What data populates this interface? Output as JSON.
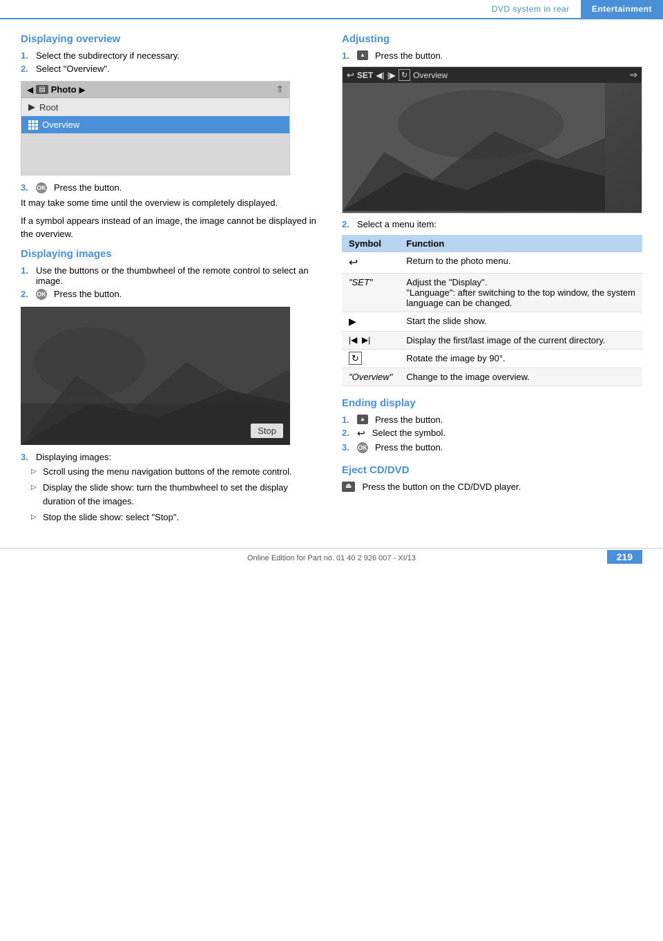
{
  "header": {
    "dvd_label": "DVD system in rear",
    "section_label": "Entertainment"
  },
  "left_col": {
    "section1_title": "Displaying overview",
    "section1_steps": [
      {
        "num": "1.",
        "text": "Select the subdirectory if necessary."
      },
      {
        "num": "2.",
        "text": "Select \"Overview\"."
      }
    ],
    "dvd_menu": {
      "topbar_center": "Photo",
      "row1": "Root",
      "row2_icon": "grid",
      "row2": "Overview"
    },
    "step3_text": "Press the button.",
    "para1": "It may take some time until the overview is completely displayed.",
    "para2": "If a symbol appears instead of an image, the image cannot be displayed in the overview.",
    "section2_title": "Displaying images",
    "section2_steps": [
      {
        "num": "1.",
        "text": "Use the buttons or the thumbwheel of the remote control to select an image."
      },
      {
        "num": "2.",
        "text": "Press the button."
      }
    ],
    "step3b_label": "3.",
    "step3b_text": "Displaying images:",
    "bullets": [
      "Scroll using the menu navigation buttons of the remote control.",
      "Display the slide show: turn the thumbwheel to set the display duration of the images.",
      "Stop the slide show: select \"Stop\"."
    ],
    "stop_badge": "Stop"
  },
  "right_col": {
    "section_adjusting_title": "Adjusting",
    "adj_step1": "Press the button.",
    "adj_step2": "Select a menu item:",
    "photo_topbar_items": [
      "SET",
      "◀|",
      "|▶",
      "↻",
      "Overview"
    ],
    "table": {
      "headers": [
        "Symbol",
        "Function"
      ],
      "rows": [
        {
          "symbol": "↩",
          "function": "Return to the photo menu."
        },
        {
          "symbol": "\"SET\"",
          "function": "Adjust the \"Display\".\n\"Language\": after switching to the top window, the system language can be changed."
        },
        {
          "symbol": "▶",
          "function": "Start the slide show."
        },
        {
          "symbol": "|◀  ▶|",
          "function": "Display the first/last image of the current directory."
        },
        {
          "symbol": "↻",
          "function": "Rotate the image by 90°."
        },
        {
          "symbol": "\"Overview\"",
          "function": "Change to the image overview."
        }
      ]
    },
    "section_ending_title": "Ending display",
    "ending_steps": [
      {
        "num": "1.",
        "text": "Press the button."
      },
      {
        "num": "2.",
        "text": "Select the symbol."
      },
      {
        "num": "3.",
        "text": "Press the button."
      }
    ],
    "section_eject_title": "Eject CD/DVD",
    "eject_text": "Press the button on the CD/DVD player."
  },
  "footer": {
    "text": "Online Edition for Part no. 01 40 2 926 007 - XI/13",
    "page": "219"
  }
}
